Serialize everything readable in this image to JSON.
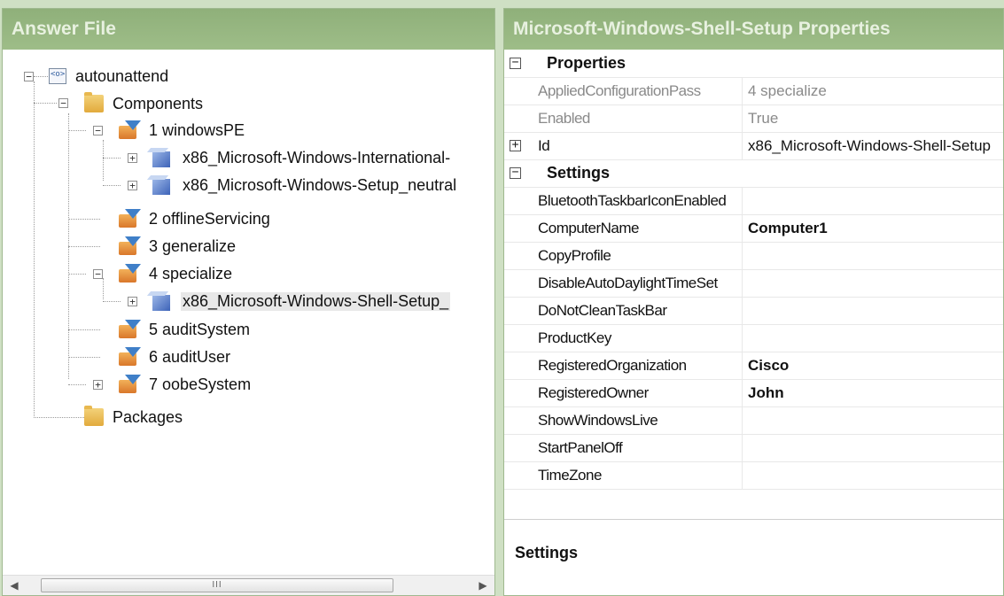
{
  "left_pane": {
    "title": "Answer File",
    "tree": {
      "root": "autounattend",
      "components": "Components",
      "pass1": "1 windowsPE",
      "pass1_child1": "x86_Microsoft-Windows-International-",
      "pass1_child2": "x86_Microsoft-Windows-Setup_neutral",
      "pass2": "2 offlineServicing",
      "pass3": "3 generalize",
      "pass4": "4 specialize",
      "pass4_child1": "x86_Microsoft-Windows-Shell-Setup_",
      "pass5": "5 auditSystem",
      "pass6": "6 auditUser",
      "pass7": "7 oobeSystem",
      "packages": "Packages"
    },
    "scrollbar": {
      "left_arrow": "◀",
      "right_arrow": "▶",
      "thumb_grip": "III"
    }
  },
  "right_pane": {
    "title": "Microsoft-Windows-Shell-Setup Properties",
    "properties_category": "Properties",
    "settings_category": "Settings",
    "properties": [
      {
        "name": "AppliedConfigurationPass",
        "value": "4 specialize"
      },
      {
        "name": "Enabled",
        "value": "True"
      },
      {
        "name": "Id",
        "value": "x86_Microsoft-Windows-Shell-Setup"
      }
    ],
    "settings": [
      {
        "name": "BluetoothTaskbarIconEnabled",
        "value": ""
      },
      {
        "name": "ComputerName",
        "value": "Computer1"
      },
      {
        "name": "CopyProfile",
        "value": ""
      },
      {
        "name": "DisableAutoDaylightTimeSet",
        "value": ""
      },
      {
        "name": "DoNotCleanTaskBar",
        "value": ""
      },
      {
        "name": "ProductKey",
        "value": ""
      },
      {
        "name": "RegisteredOrganization",
        "value": "Cisco"
      },
      {
        "name": "RegisteredOwner",
        "value": "John"
      },
      {
        "name": "ShowWindowsLive",
        "value": ""
      },
      {
        "name": "StartPanelOff",
        "value": ""
      },
      {
        "name": "TimeZone",
        "value": ""
      }
    ],
    "description_title": "Settings"
  }
}
